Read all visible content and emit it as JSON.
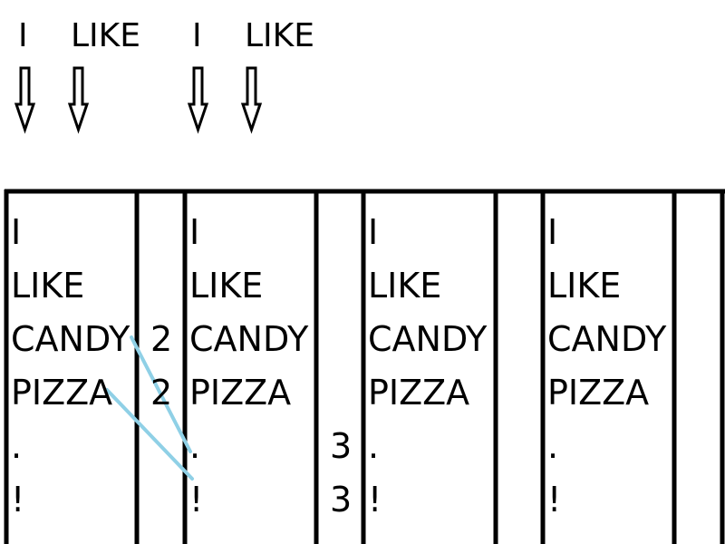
{
  "header_words": [
    "I",
    "LIKE",
    "I",
    "LIKE"
  ],
  "column_words": [
    "I",
    "LIKE",
    "CANDY",
    "PIZZA",
    ".",
    "!"
  ],
  "counts": [
    {
      "column": 1,
      "values": [
        "2",
        "2"
      ]
    },
    {
      "column": 2,
      "values": [
        "3",
        "3"
      ]
    }
  ],
  "colors": {
    "line": "#000000",
    "link": "#8fd0e6"
  }
}
